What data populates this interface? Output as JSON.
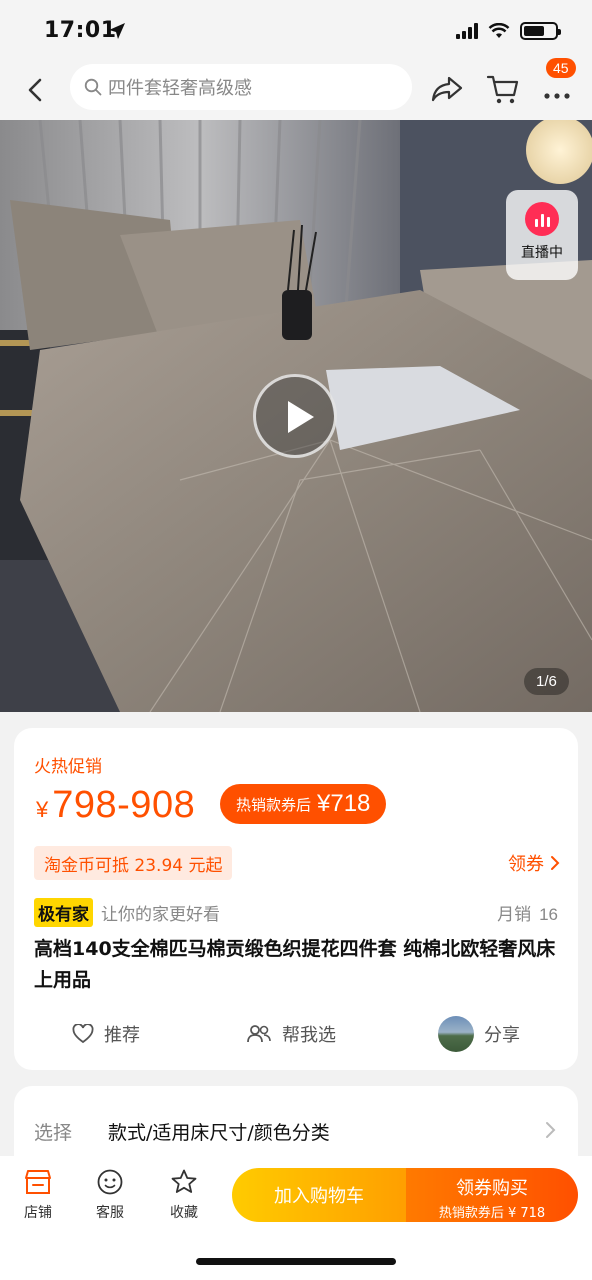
{
  "status_bar": {
    "time": "17:01"
  },
  "nav": {
    "search_placeholder": "四件套轻奢高级感",
    "cart_badge": "45",
    "icons": [
      "back-icon",
      "search-icon",
      "share-icon",
      "cart-icon",
      "more-icon"
    ]
  },
  "hero": {
    "live_label": "直播中",
    "image_counter": "1/6"
  },
  "product": {
    "promo_title": "火热促销",
    "currency": "¥",
    "price_range": "798-908",
    "coupon_label": "热销款券后",
    "coupon_price": "¥718",
    "coin_text": "淘金币可抵 23.94 元起",
    "get_coupon": "领券",
    "brand_tag": "极有家",
    "brand_slogan": "让你的家更好看",
    "sales_label": "月销",
    "sales_count": "16",
    "title": "高档140支全棉匹马棉贡缎色织提花四件套 纯棉北欧轻奢风床上用品",
    "actions": {
      "recommend": "推荐",
      "help_choose": "帮我选",
      "share": "分享"
    }
  },
  "selection": {
    "label": "选择",
    "value": "款式/适用床尺寸/颜色分类"
  },
  "bottom_bar": {
    "store": "店铺",
    "service": "客服",
    "favorite": "收藏",
    "add_to_cart": "加入购物车",
    "buy": "领券购买",
    "buy_sub": "热销款券后 ¥ 718"
  },
  "colors": {
    "accent": "#ff5000",
    "cart_button": "#ffb300",
    "brand_tag": "#ffd600"
  }
}
